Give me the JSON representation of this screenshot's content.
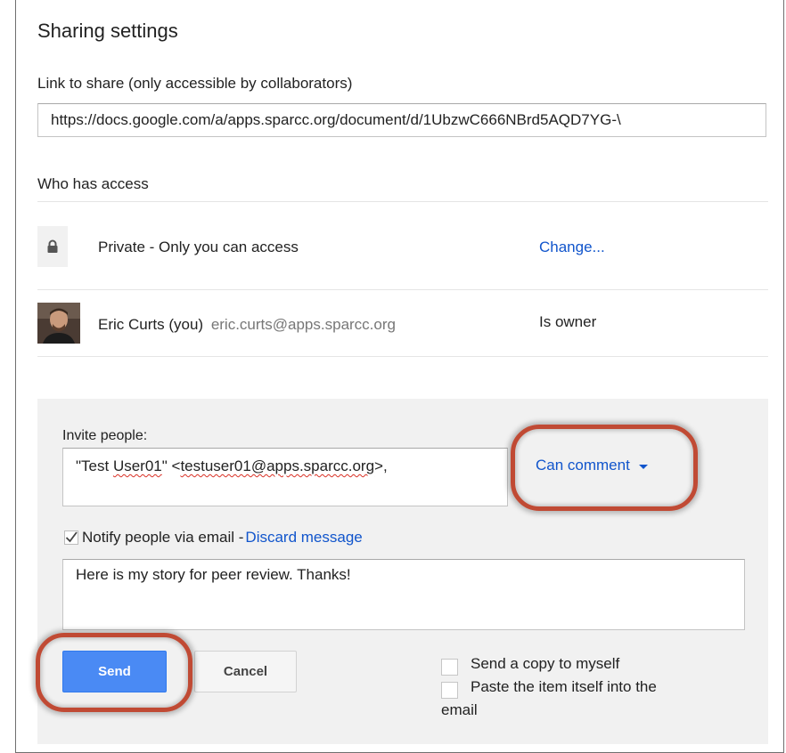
{
  "dialog": {
    "title": "Sharing settings",
    "link_label": "Link to share (only accessible by collaborators)",
    "link_value": "https://docs.google.com/a/apps.sparcc.org/document/d/1UbzwC666NBrd5AQD7YG-\\"
  },
  "access": {
    "label": "Who has access",
    "rows": [
      {
        "icon": "lock-icon",
        "name": "Private - Only you can access",
        "action": "Change..."
      },
      {
        "icon": "avatar",
        "name": "Eric Curts (you)",
        "email": "eric.curts@apps.sparcc.org",
        "role": "Is owner"
      }
    ]
  },
  "invite": {
    "label": "Invite people:",
    "value_prefix": "\"Test ",
    "value_user": "User01",
    "value_mid": "\" <",
    "value_email": "testuser01@apps.sparcc.org",
    "value_suffix": ">,",
    "permission": "Can comment",
    "notify_label": "Notify people via email - ",
    "notify_checked": true,
    "discard_label": "Discard message",
    "message": "Here is my story for peer review. Thanks!",
    "send_label": "Send",
    "cancel_label": "Cancel",
    "copy_label": "Send a copy to myself",
    "paste_label_line1": "Paste the item itself into the",
    "paste_label_line2": "email"
  },
  "colors": {
    "link": "#1155cc",
    "send_button": "#4a8af4",
    "highlight_ring": "#c04a34",
    "panel_bg": "#f1f1f1"
  }
}
